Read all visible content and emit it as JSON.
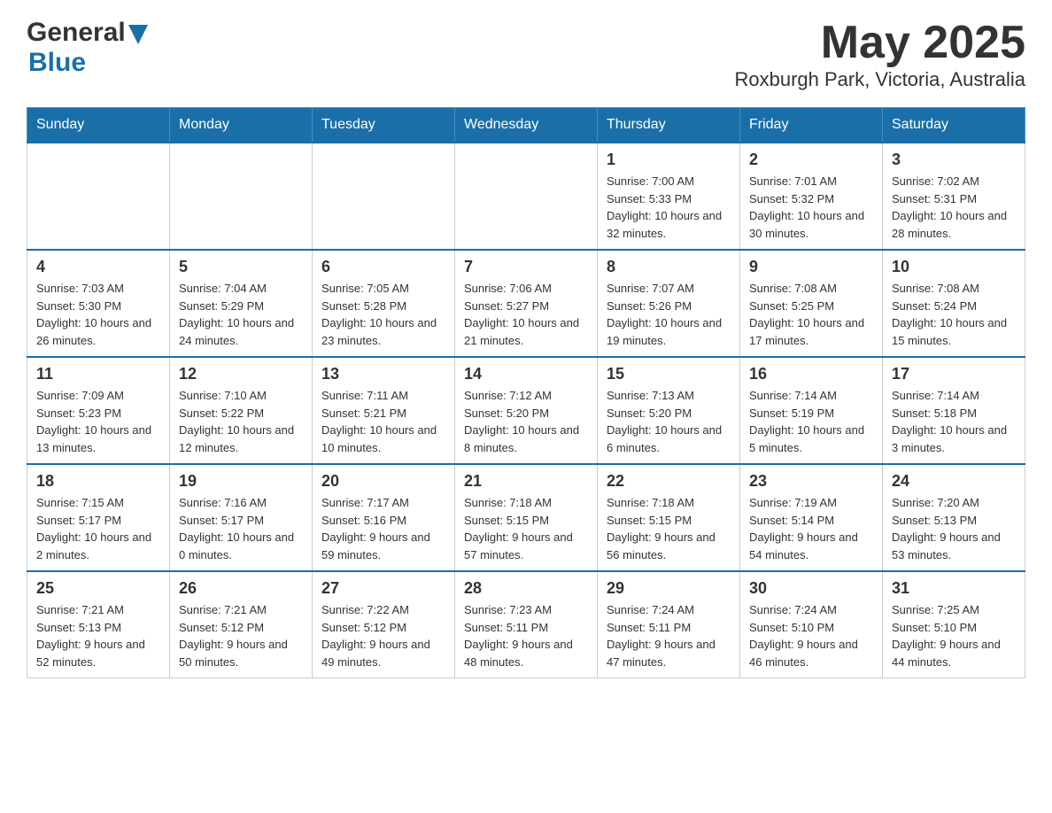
{
  "header": {
    "logo_general": "General",
    "logo_blue": "Blue",
    "title": "May 2025",
    "subtitle": "Roxburgh Park, Victoria, Australia"
  },
  "days_of_week": [
    "Sunday",
    "Monday",
    "Tuesday",
    "Wednesday",
    "Thursday",
    "Friday",
    "Saturday"
  ],
  "weeks": [
    {
      "days": [
        {
          "number": "",
          "info": ""
        },
        {
          "number": "",
          "info": ""
        },
        {
          "number": "",
          "info": ""
        },
        {
          "number": "",
          "info": ""
        },
        {
          "number": "1",
          "info": "Sunrise: 7:00 AM\nSunset: 5:33 PM\nDaylight: 10 hours and 32 minutes."
        },
        {
          "number": "2",
          "info": "Sunrise: 7:01 AM\nSunset: 5:32 PM\nDaylight: 10 hours and 30 minutes."
        },
        {
          "number": "3",
          "info": "Sunrise: 7:02 AM\nSunset: 5:31 PM\nDaylight: 10 hours and 28 minutes."
        }
      ]
    },
    {
      "days": [
        {
          "number": "4",
          "info": "Sunrise: 7:03 AM\nSunset: 5:30 PM\nDaylight: 10 hours and 26 minutes."
        },
        {
          "number": "5",
          "info": "Sunrise: 7:04 AM\nSunset: 5:29 PM\nDaylight: 10 hours and 24 minutes."
        },
        {
          "number": "6",
          "info": "Sunrise: 7:05 AM\nSunset: 5:28 PM\nDaylight: 10 hours and 23 minutes."
        },
        {
          "number": "7",
          "info": "Sunrise: 7:06 AM\nSunset: 5:27 PM\nDaylight: 10 hours and 21 minutes."
        },
        {
          "number": "8",
          "info": "Sunrise: 7:07 AM\nSunset: 5:26 PM\nDaylight: 10 hours and 19 minutes."
        },
        {
          "number": "9",
          "info": "Sunrise: 7:08 AM\nSunset: 5:25 PM\nDaylight: 10 hours and 17 minutes."
        },
        {
          "number": "10",
          "info": "Sunrise: 7:08 AM\nSunset: 5:24 PM\nDaylight: 10 hours and 15 minutes."
        }
      ]
    },
    {
      "days": [
        {
          "number": "11",
          "info": "Sunrise: 7:09 AM\nSunset: 5:23 PM\nDaylight: 10 hours and 13 minutes."
        },
        {
          "number": "12",
          "info": "Sunrise: 7:10 AM\nSunset: 5:22 PM\nDaylight: 10 hours and 12 minutes."
        },
        {
          "number": "13",
          "info": "Sunrise: 7:11 AM\nSunset: 5:21 PM\nDaylight: 10 hours and 10 minutes."
        },
        {
          "number": "14",
          "info": "Sunrise: 7:12 AM\nSunset: 5:20 PM\nDaylight: 10 hours and 8 minutes."
        },
        {
          "number": "15",
          "info": "Sunrise: 7:13 AM\nSunset: 5:20 PM\nDaylight: 10 hours and 6 minutes."
        },
        {
          "number": "16",
          "info": "Sunrise: 7:14 AM\nSunset: 5:19 PM\nDaylight: 10 hours and 5 minutes."
        },
        {
          "number": "17",
          "info": "Sunrise: 7:14 AM\nSunset: 5:18 PM\nDaylight: 10 hours and 3 minutes."
        }
      ]
    },
    {
      "days": [
        {
          "number": "18",
          "info": "Sunrise: 7:15 AM\nSunset: 5:17 PM\nDaylight: 10 hours and 2 minutes."
        },
        {
          "number": "19",
          "info": "Sunrise: 7:16 AM\nSunset: 5:17 PM\nDaylight: 10 hours and 0 minutes."
        },
        {
          "number": "20",
          "info": "Sunrise: 7:17 AM\nSunset: 5:16 PM\nDaylight: 9 hours and 59 minutes."
        },
        {
          "number": "21",
          "info": "Sunrise: 7:18 AM\nSunset: 5:15 PM\nDaylight: 9 hours and 57 minutes."
        },
        {
          "number": "22",
          "info": "Sunrise: 7:18 AM\nSunset: 5:15 PM\nDaylight: 9 hours and 56 minutes."
        },
        {
          "number": "23",
          "info": "Sunrise: 7:19 AM\nSunset: 5:14 PM\nDaylight: 9 hours and 54 minutes."
        },
        {
          "number": "24",
          "info": "Sunrise: 7:20 AM\nSunset: 5:13 PM\nDaylight: 9 hours and 53 minutes."
        }
      ]
    },
    {
      "days": [
        {
          "number": "25",
          "info": "Sunrise: 7:21 AM\nSunset: 5:13 PM\nDaylight: 9 hours and 52 minutes."
        },
        {
          "number": "26",
          "info": "Sunrise: 7:21 AM\nSunset: 5:12 PM\nDaylight: 9 hours and 50 minutes."
        },
        {
          "number": "27",
          "info": "Sunrise: 7:22 AM\nSunset: 5:12 PM\nDaylight: 9 hours and 49 minutes."
        },
        {
          "number": "28",
          "info": "Sunrise: 7:23 AM\nSunset: 5:11 PM\nDaylight: 9 hours and 48 minutes."
        },
        {
          "number": "29",
          "info": "Sunrise: 7:24 AM\nSunset: 5:11 PM\nDaylight: 9 hours and 47 minutes."
        },
        {
          "number": "30",
          "info": "Sunrise: 7:24 AM\nSunset: 5:10 PM\nDaylight: 9 hours and 46 minutes."
        },
        {
          "number": "31",
          "info": "Sunrise: 7:25 AM\nSunset: 5:10 PM\nDaylight: 9 hours and 44 minutes."
        }
      ]
    }
  ]
}
